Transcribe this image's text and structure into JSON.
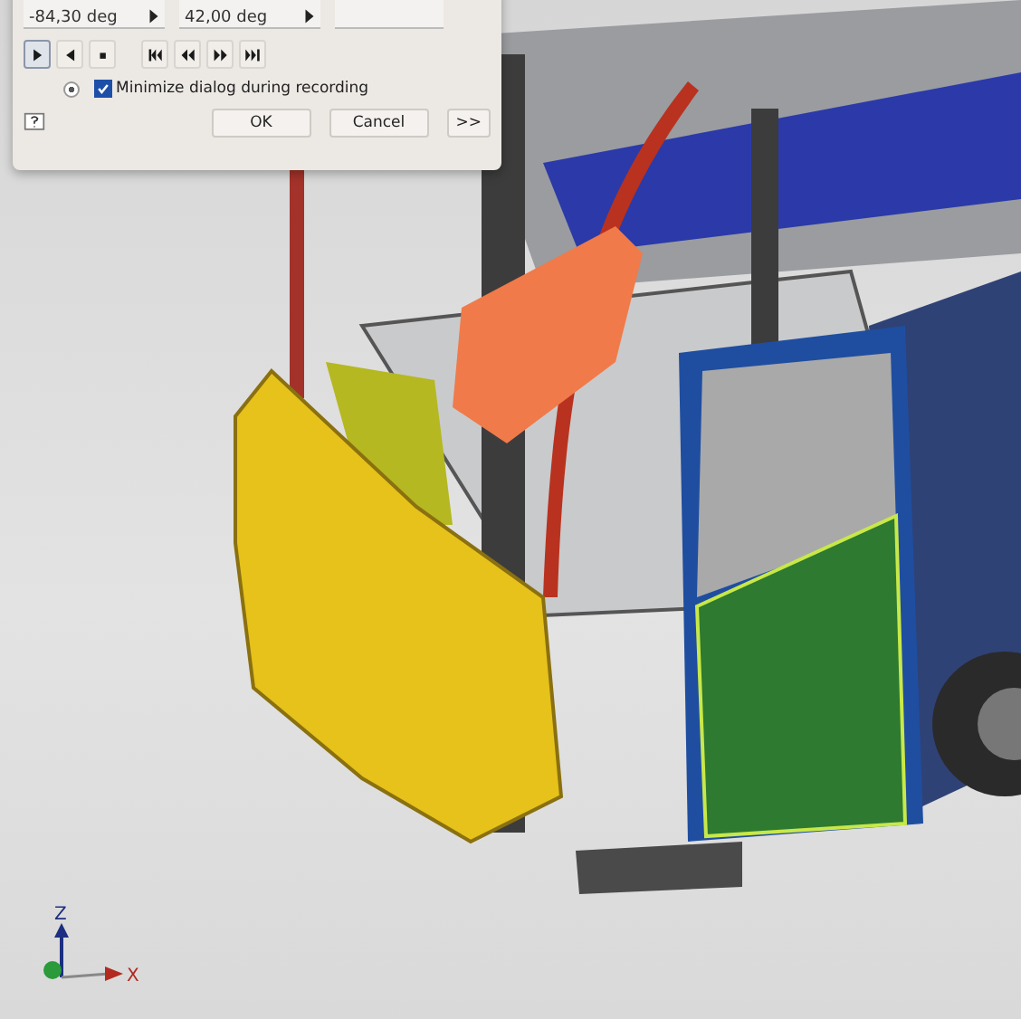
{
  "dialog": {
    "angle_fields": [
      {
        "value": "-84,30 deg"
      },
      {
        "value": "42,00 deg"
      }
    ],
    "transport_buttons": [
      {
        "kind": "play",
        "selected": true
      },
      {
        "kind": "reverse",
        "selected": false
      },
      {
        "kind": "stop",
        "selected": false
      }
    ],
    "seek_buttons": [
      {
        "kind": "first"
      },
      {
        "kind": "back"
      },
      {
        "kind": "forward"
      },
      {
        "kind": "last"
      }
    ],
    "record_radio": {
      "selected": true
    },
    "minimize_checkbox": {
      "label": "Minimize dialog during recording",
      "checked": true
    },
    "buttons": [
      {
        "label": "OK"
      },
      {
        "label": "Cancel"
      },
      {
        "label": ">>"
      }
    ]
  },
  "axis_triad": {
    "z_label": "Z",
    "x_label": "X"
  }
}
